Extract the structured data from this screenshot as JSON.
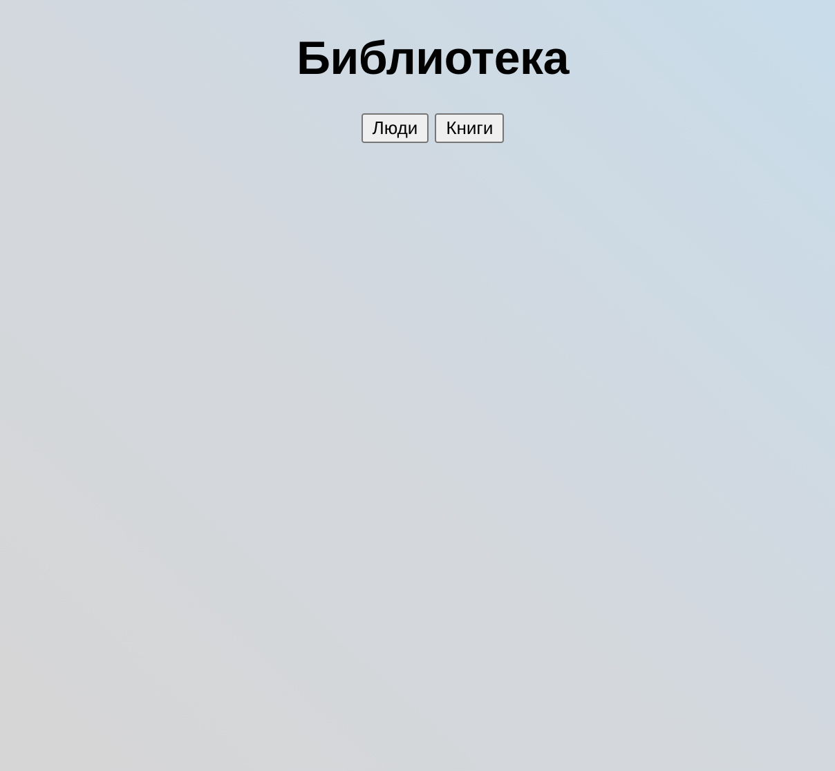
{
  "page": {
    "title": "Библиотека"
  },
  "nav": {
    "buttons": [
      {
        "label": "Люди"
      },
      {
        "label": "Книги"
      }
    ]
  }
}
